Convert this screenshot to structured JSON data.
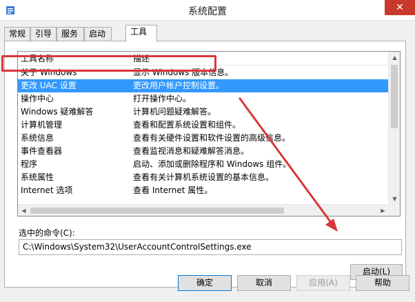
{
  "window": {
    "title": "系统配置",
    "close_symbol": "✕",
    "icon": "msconfig-app-icon"
  },
  "tabs": [
    {
      "label": "常规",
      "active": false
    },
    {
      "label": "引导",
      "active": false
    },
    {
      "label": "服务",
      "active": false
    },
    {
      "label": "启动",
      "active": false
    },
    {
      "label": "工具",
      "active": true
    }
  ],
  "tools_list": {
    "headers": {
      "name": "工具名称",
      "description": "描述"
    },
    "rows": [
      {
        "name": "关于 Windows",
        "description": "显示 Windows 版本信息。",
        "selected": false
      },
      {
        "name": "更改 UAC 设置",
        "description": "更改用户帐户控制设置。",
        "selected": true
      },
      {
        "name": "操作中心",
        "description": "打开操作中心。",
        "selected": false
      },
      {
        "name": "Windows 疑难解答",
        "description": "计算机问题疑难解答。",
        "selected": false
      },
      {
        "name": "计算机管理",
        "description": "查看和配置系统设置和组件。",
        "selected": false
      },
      {
        "name": "系统信息",
        "description": "查看有关硬件设置和软件设置的高级信息。",
        "selected": false
      },
      {
        "name": "事件查看器",
        "description": "查看监视消息和疑难解答消息。",
        "selected": false
      },
      {
        "name": "程序",
        "description": "启动、添加或删除程序和 Windows 组件。",
        "selected": false
      },
      {
        "name": "系统属性",
        "description": "查看有关计算机系统设置的基本信息。",
        "selected": false
      },
      {
        "name": "Internet 选项",
        "description": "查看 Internet 属性。",
        "selected": false
      }
    ]
  },
  "selected_command": {
    "label": "选中的命令(C):",
    "value": "C:\\Windows\\System32\\UserAccountControlSettings.exe"
  },
  "buttons": {
    "launch": "启动(L)",
    "ok": "确定",
    "cancel": "取消",
    "apply": "应用(A)",
    "help": "帮助"
  },
  "colors": {
    "selection": "#3399ff",
    "annotation_red": "#d9353a",
    "close_red": "#c7392b"
  }
}
